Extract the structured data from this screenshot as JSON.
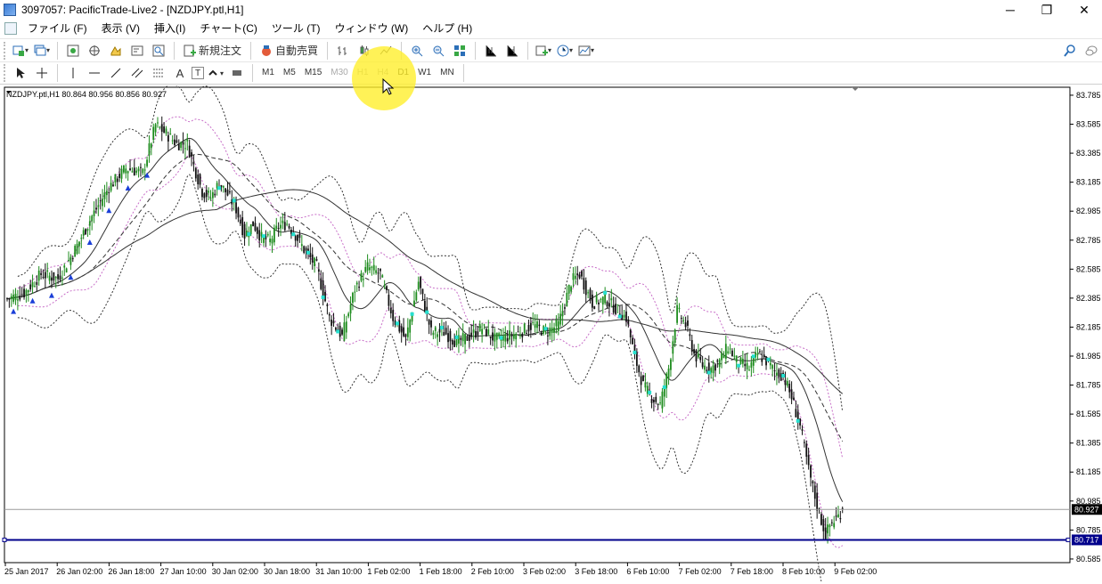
{
  "window": {
    "title": "3097057: PacificTrade-Live2 - [NZDJPY.ptl,H1]"
  },
  "menu": [
    "ファイル (F)",
    "表示 (V)",
    "挿入(I)",
    "チャート(C)",
    "ツール (T)",
    "ウィンドウ (W)",
    "ヘルプ (H)"
  ],
  "toolbar": {
    "new_order": "新規注文",
    "auto_trade": "自動売買"
  },
  "timeframes": [
    "M1",
    "M5",
    "M15",
    "M30",
    "H1",
    "H4",
    "D1",
    "W1",
    "MN"
  ],
  "drawing_tools": {
    "text": "A",
    "text_label": "T"
  },
  "chart": {
    "symbol_info": "NZDJPY.ptl,H1  80.864 80.956 80.856 80.927",
    "current_price": "80.927",
    "hline_price": "80.717"
  },
  "chart_data": {
    "type": "candlestick",
    "symbol": "NZDJPY.ptl",
    "timeframe": "H1",
    "x_tick_labels": [
      "25 Jan 2017",
      "26 Jan 02:00",
      "26 Jan 18:00",
      "27 Jan 10:00",
      "30 Jan 02:00",
      "30 Jan 18:00",
      "31 Jan 10:00",
      "1 Feb 02:00",
      "1 Feb 18:00",
      "2 Feb 10:00",
      "3 Feb 02:00",
      "3 Feb 18:00",
      "6 Feb 10:00",
      "7 Feb 02:00",
      "7 Feb 18:00",
      "8 Feb 10:00",
      "9 Feb 02:00"
    ],
    "y_tick_labels": [
      "83.785",
      "83.585",
      "83.385",
      "83.185",
      "82.985",
      "82.785",
      "82.585",
      "82.385",
      "82.185",
      "81.985",
      "81.785",
      "81.585",
      "81.385",
      "81.185",
      "80.985",
      "80.785",
      "80.585"
    ],
    "ylim": [
      80.56,
      83.84
    ],
    "last_close": 80.927,
    "horizontal_line": 80.717,
    "path": [
      [
        0,
        82.38
      ],
      [
        8,
        82.42
      ],
      [
        16,
        82.55
      ],
      [
        24,
        82.52
      ],
      [
        32,
        82.72
      ],
      [
        40,
        82.95
      ],
      [
        48,
        83.15
      ],
      [
        56,
        83.28
      ],
      [
        64,
        83.25
      ],
      [
        70,
        83.58
      ],
      [
        75,
        83.52
      ],
      [
        80,
        83.45
      ],
      [
        85,
        83.45
      ],
      [
        88,
        83.3
      ],
      [
        92,
        83.12
      ],
      [
        96,
        83.08
      ],
      [
        100,
        83.18
      ],
      [
        104,
        83.1
      ],
      [
        108,
        83.0
      ],
      [
        112,
        82.82
      ],
      [
        116,
        82.9
      ],
      [
        120,
        82.8
      ],
      [
        124,
        82.78
      ],
      [
        128,
        82.88
      ],
      [
        132,
        82.9
      ],
      [
        136,
        82.82
      ],
      [
        140,
        82.72
      ],
      [
        146,
        82.6
      ],
      [
        152,
        82.25
      ],
      [
        158,
        82.12
      ],
      [
        164,
        82.45
      ],
      [
        170,
        82.6
      ],
      [
        176,
        82.55
      ],
      [
        182,
        82.25
      ],
      [
        188,
        82.1
      ],
      [
        194,
        82.5
      ],
      [
        200,
        82.15
      ],
      [
        206,
        82.15
      ],
      [
        212,
        82.08
      ],
      [
        218,
        82.12
      ],
      [
        224,
        82.18
      ],
      [
        230,
        82.1
      ],
      [
        236,
        82.12
      ],
      [
        242,
        82.15
      ],
      [
        248,
        82.2
      ],
      [
        254,
        82.15
      ],
      [
        260,
        82.2
      ],
      [
        266,
        82.5
      ],
      [
        270,
        82.55
      ],
      [
        276,
        82.35
      ],
      [
        282,
        82.38
      ],
      [
        288,
        82.3
      ],
      [
        292,
        82.25
      ],
      [
        296,
        81.98
      ],
      [
        300,
        81.78
      ],
      [
        304,
        81.7
      ],
      [
        308,
        81.65
      ],
      [
        312,
        81.9
      ],
      [
        316,
        82.3
      ],
      [
        320,
        82.2
      ],
      [
        324,
        82.0
      ],
      [
        328,
        81.92
      ],
      [
        332,
        81.9
      ],
      [
        336,
        81.95
      ],
      [
        340,
        82.05
      ],
      [
        344,
        81.95
      ],
      [
        350,
        81.9
      ],
      [
        354,
        82.0
      ],
      [
        358,
        81.95
      ],
      [
        362,
        81.88
      ],
      [
        366,
        81.85
      ],
      [
        370,
        81.7
      ],
      [
        374,
        81.5
      ],
      [
        378,
        81.2
      ],
      [
        382,
        80.95
      ],
      [
        386,
        80.75
      ],
      [
        388,
        80.82
      ],
      [
        390,
        80.85
      ],
      [
        392,
        80.88
      ],
      [
        394,
        80.93
      ]
    ],
    "indicators": [
      "Moving Average (fast)",
      "Moving Average (medium)",
      "Moving Average (slow)",
      "Bollinger Bands (inner)",
      "Bollinger Bands (outer)",
      "Signal arrows"
    ],
    "colors": {
      "bull_candle": "#1e8c1e",
      "bear_candle": "#111111",
      "ma": "#333333",
      "bands_inner": "#c86ec8",
      "bands_outer": "#333333",
      "arrow_up": "#1b3fd8",
      "arrow_cyan": "#27e0d0",
      "hline": "#00008b"
    }
  }
}
